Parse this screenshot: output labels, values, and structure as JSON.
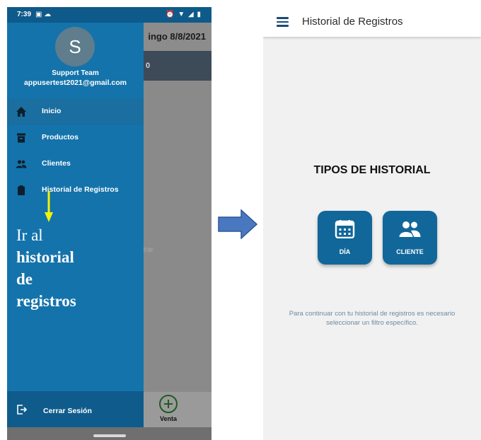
{
  "left_screen": {
    "status_bar": {
      "time": "7:39",
      "left_icons": "▣ ☁",
      "right_icons": "⏰ ▼ ◢ ▮"
    },
    "background_app": {
      "header_date": "ingo 8/8/2021",
      "band_value": "0",
      "faint_text": "trar",
      "venta_label": "Venta"
    },
    "drawer": {
      "avatar_letter": "S",
      "user_name": "Support Team",
      "user_email": "appusertest2021@gmail.com",
      "items": [
        {
          "label": "Inicio",
          "icon": "home-icon",
          "active": true
        },
        {
          "label": "Productos",
          "icon": "archive-box-icon",
          "active": false
        },
        {
          "label": "Clientes",
          "icon": "users-icon",
          "active": false
        },
        {
          "label": "Historial de Registros",
          "icon": "clipboard-icon",
          "active": false
        }
      ],
      "logout_label": "Cerrar Sesión"
    },
    "annotation": {
      "line1": "Ir al",
      "line2": "historial",
      "line3": "de",
      "line4": "registros"
    }
  },
  "right_screen": {
    "title": "Historial de Registros",
    "section_title": "TIPOS DE HISTORIAL",
    "tiles": [
      {
        "label": "DÍA",
        "icon": "calendar-icon"
      },
      {
        "label": "CLIENTE",
        "icon": "users-icon"
      }
    ],
    "info_text": "Para continuar con tu historial de registros es necesario seleccionar un filtro específico."
  },
  "colors": {
    "drawer_blue": "#1473ab",
    "tile_blue": "#11679a",
    "annotation_arrow": "#f2f20a",
    "flow_arrow": "#4a78c0"
  }
}
